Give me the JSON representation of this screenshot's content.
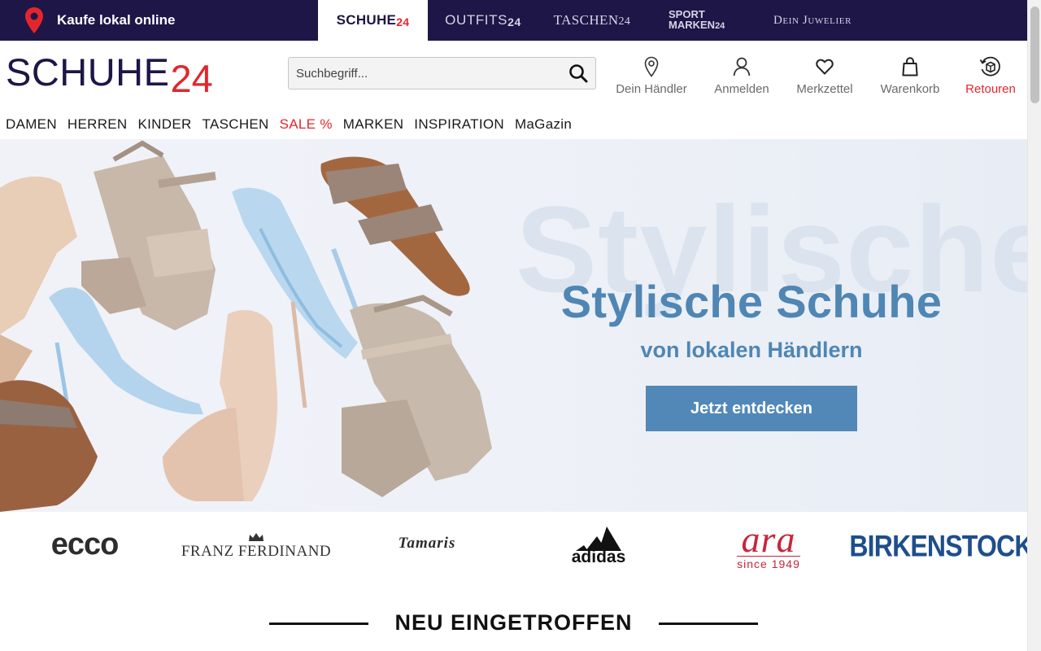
{
  "topbar": {
    "local_label": "Kaufe lokal online",
    "tabs": [
      {
        "name": "SCHUHE",
        "suffix": "24",
        "active": true
      },
      {
        "name": "OUTFITS",
        "suffix": "24",
        "active": false
      },
      {
        "name": "TASCHEN",
        "suffix": "24",
        "active": false
      },
      {
        "name_line1": "Sport",
        "name_line2": "Marken",
        "suffix": "24",
        "active": false
      },
      {
        "name": "Dein Juwelier",
        "active": false
      }
    ]
  },
  "header": {
    "logo_word": "SCHUHE",
    "logo_num": "24",
    "search_placeholder": "Suchbegriff...",
    "actions": [
      {
        "label": "Dein Händler",
        "icon": "location-pin-icon"
      },
      {
        "label": "Anmelden",
        "icon": "user-icon"
      },
      {
        "label": "Merkzettel",
        "icon": "heart-icon"
      },
      {
        "label": "Warenkorb",
        "icon": "shopping-bag-icon"
      },
      {
        "label": "Retouren",
        "icon": "return-box-icon"
      }
    ]
  },
  "nav": [
    "DAMEN",
    "HERREN",
    "KINDER",
    "TASCHEN",
    "SALE %",
    "MARKEN",
    "INSPIRATION",
    "MaGazin"
  ],
  "hero": {
    "ghost_word": "Stylische",
    "headline": "Stylische Schuhe",
    "subline": "von lokalen Händlern",
    "cta": "Jetzt entdecken"
  },
  "brands": {
    "ecco": "ecco",
    "franz": "FRANZ FERDINAND",
    "tamaris": "Tamaris",
    "adidas": "adidas",
    "ara": "ara",
    "ara_since": "since 1949",
    "birkenstock": "BIRKENSTOCK"
  },
  "section": {
    "title": "NEU EINGETROFFEN"
  },
  "colors": {
    "navy": "#1d1647",
    "red": "#e3262c",
    "hero_blue": "#4f86b4",
    "cta_blue": "#5288b8"
  }
}
